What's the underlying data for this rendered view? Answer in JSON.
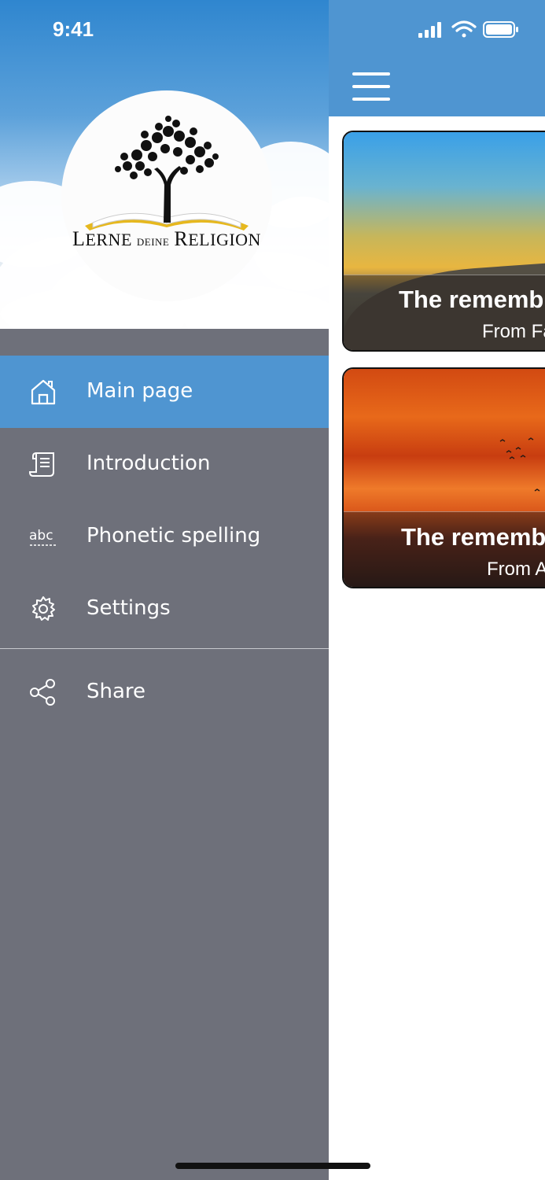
{
  "status_bar": {
    "time": "9:41",
    "icons": [
      "signal-icon",
      "wifi-icon",
      "battery-icon"
    ]
  },
  "drawer": {
    "logo": {
      "text_big_1": "L",
      "text_rest_1": "ERNE",
      "text_small": "DEINE",
      "text_big_2": "R",
      "text_rest_2": "ELIGION"
    },
    "menu": [
      {
        "label": "Main page",
        "icon": "home-icon",
        "active": true
      },
      {
        "label": "Introduction",
        "icon": "document-icon",
        "active": false
      },
      {
        "label": "Phonetic spelling",
        "icon": "abc-icon",
        "active": false
      },
      {
        "label": "Settings",
        "icon": "gear-icon",
        "active": false
      }
    ],
    "share": {
      "label": "Share",
      "icon": "share-icon"
    }
  },
  "main": {
    "header": {
      "menu_icon": "hamburger-icon"
    },
    "cards": [
      {
        "title": "The rememb",
        "subtitle": "From Fa"
      },
      {
        "title": "The rememb",
        "subtitle": "From A"
      }
    ]
  },
  "colors": {
    "accent": "#4f95d1",
    "drawer_bg": "#6e707a",
    "header_blue": "#4f95d1"
  }
}
